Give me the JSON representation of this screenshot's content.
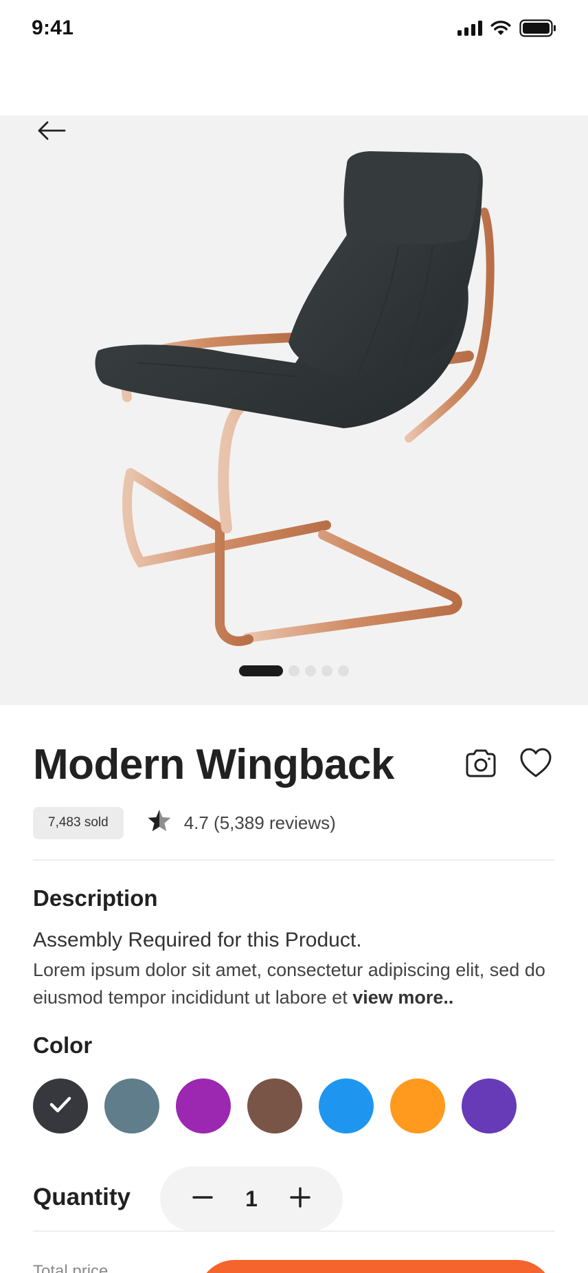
{
  "status_bar": {
    "time": "9:41",
    "icons": [
      "signal-icon",
      "wifi-icon",
      "battery-icon"
    ]
  },
  "hero": {
    "back_icon": "arrow-left-icon",
    "image": "wingback-chair-image",
    "carousel": {
      "total": 5,
      "active_index": 0
    }
  },
  "product": {
    "title": "Modern Wingback",
    "camera_icon": "camera-icon",
    "favorite_icon": "heart-icon",
    "sold": "7,483 sold",
    "rating_text": "4.7 (5,389 reviews)"
  },
  "description": {
    "label": "Description",
    "heading": "Assembly Required for this Product.",
    "body": "Lorem ipsum dolor sit amet, consectetur adipiscing elit, sed do eiusmod tempor incididunt ut labore et",
    "more": "view more.."
  },
  "color": {
    "label": "Color",
    "options": [
      "#36383d",
      "#5f7d8a",
      "#9c27b0",
      "#795548",
      "#1e96f0",
      "#ff9a1f",
      "#673ab7"
    ],
    "selected_index": 0
  },
  "quantity": {
    "label": "Quantity",
    "value": "1"
  },
  "footer": {
    "total_label": "Total price"
  },
  "colors": {
    "accent": "#f4642c",
    "hero_bg": "#f3f2f2"
  }
}
